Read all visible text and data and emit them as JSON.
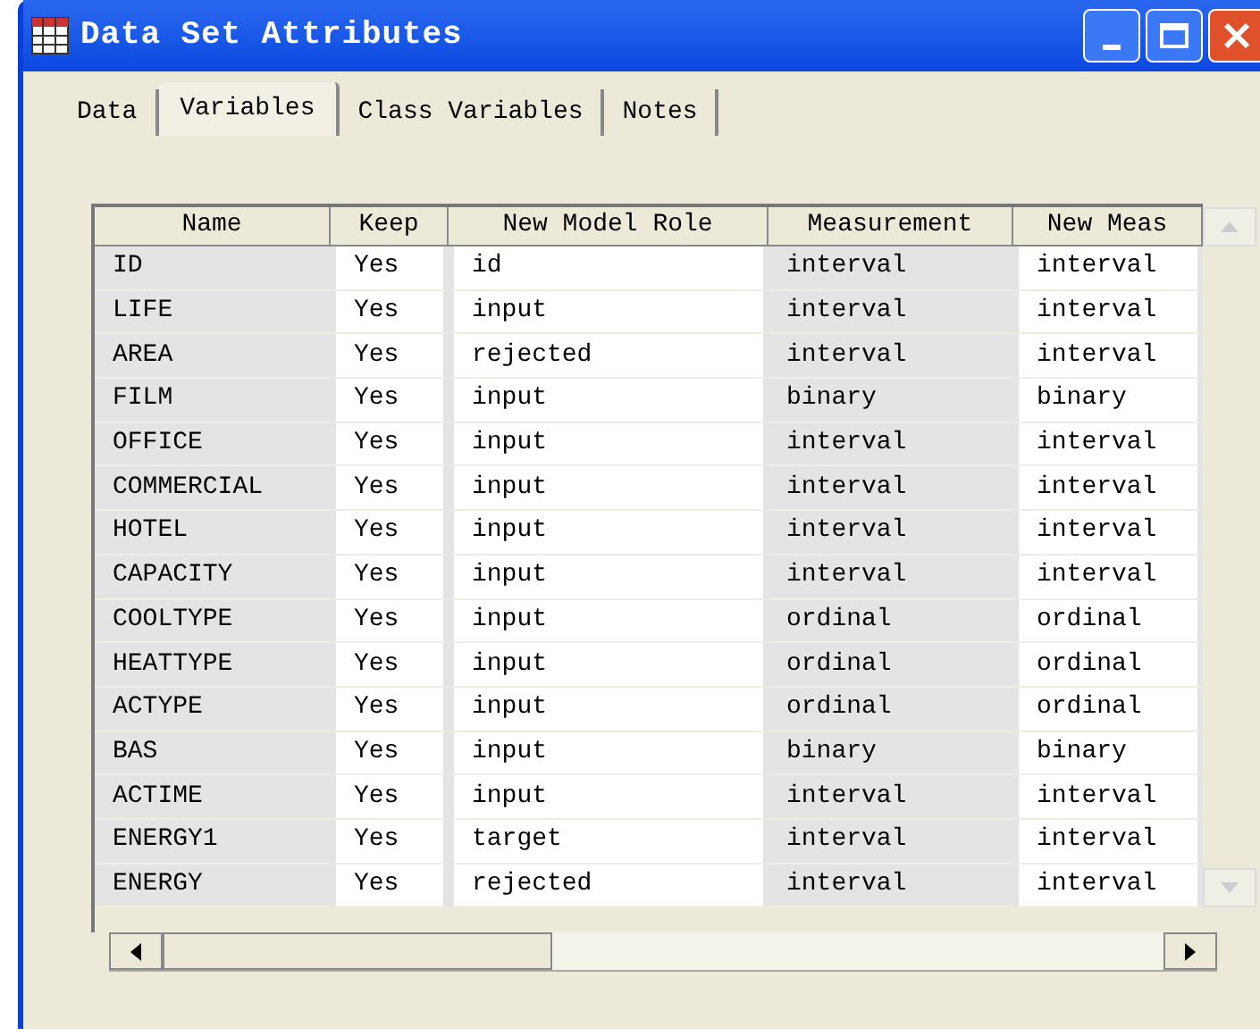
{
  "window": {
    "title": "Data Set Attributes"
  },
  "tabs": [
    {
      "label": "Data",
      "selected": false
    },
    {
      "label": "Variables",
      "selected": true
    },
    {
      "label": "Class Variables",
      "selected": false
    },
    {
      "label": "Notes",
      "selected": false
    }
  ],
  "table": {
    "columns": [
      "Name",
      "Keep",
      "New Model Role",
      "Measurement",
      "New Meas"
    ],
    "rows": [
      [
        "ID",
        "Yes",
        "id",
        "interval",
        "interval"
      ],
      [
        "LIFE",
        "Yes",
        "input",
        "interval",
        "interval"
      ],
      [
        "AREA",
        "Yes",
        "rejected",
        "interval",
        "interval"
      ],
      [
        "FILM",
        "Yes",
        "input",
        "binary",
        "binary"
      ],
      [
        "OFFICE",
        "Yes",
        "input",
        "interval",
        "interval"
      ],
      [
        "COMMERCIAL",
        "Yes",
        "input",
        "interval",
        "interval"
      ],
      [
        "HOTEL",
        "Yes",
        "input",
        "interval",
        "interval"
      ],
      [
        "CAPACITY",
        "Yes",
        "input",
        "interval",
        "interval"
      ],
      [
        "COOLTYPE",
        "Yes",
        "input",
        "ordinal",
        "ordinal"
      ],
      [
        "HEATTYPE",
        "Yes",
        "input",
        "ordinal",
        "ordinal"
      ],
      [
        "ACTYPE",
        "Yes",
        "input",
        "ordinal",
        "ordinal"
      ],
      [
        "BAS",
        "Yes",
        "input",
        "binary",
        "binary"
      ],
      [
        "ACTIME",
        "Yes",
        "input",
        "interval",
        "interval"
      ],
      [
        "ENERGY1",
        "Yes",
        "target",
        "interval",
        "interval"
      ],
      [
        "ENERGY",
        "Yes",
        "rejected",
        "interval",
        "interval"
      ]
    ]
  }
}
